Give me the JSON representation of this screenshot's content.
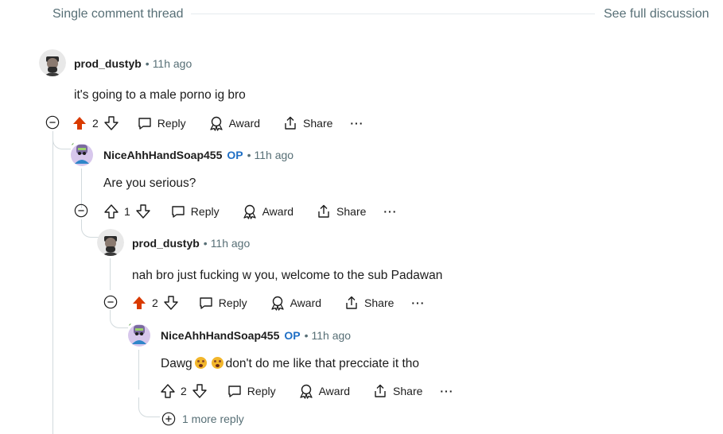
{
  "header": {
    "title": "Single comment thread",
    "see_full": "See full discussion"
  },
  "comments": [
    {
      "user": "prod_dustyb",
      "op": "",
      "time": "11h ago",
      "text": "it's going to a male porno ig bro",
      "score": "2",
      "upvoted": true
    },
    {
      "user": "NiceAhhHandSoap455",
      "op": "OP",
      "time": "11h ago",
      "text": "Are you serious?",
      "score": "1",
      "upvoted": false
    },
    {
      "user": "prod_dustyb",
      "op": "",
      "time": "11h ago",
      "text": "nah bro just fucking w you, welcome to the sub Padawan",
      "score": "2",
      "upvoted": true
    },
    {
      "user": "NiceAhhHandSoap455",
      "op": "OP",
      "time": "11h ago",
      "text_before": "Dawg",
      "text_after": "don't do me like that precciate it tho",
      "score": "2",
      "upvoted": false
    }
  ],
  "actions": {
    "reply": "Reply",
    "award": "Award",
    "share": "Share",
    "more": "···"
  },
  "more_replies": "1 more reply",
  "colors": {
    "upvote": "#d93a00",
    "op": "#1f6fc5",
    "muted": "#576f76",
    "rail": "#d2dadd"
  },
  "icons": [
    "minus-circle-icon",
    "upvote-icon",
    "downvote-icon",
    "comment-icon",
    "award-icon",
    "share-icon",
    "more-icon",
    "plus-circle-icon",
    "avatar"
  ]
}
